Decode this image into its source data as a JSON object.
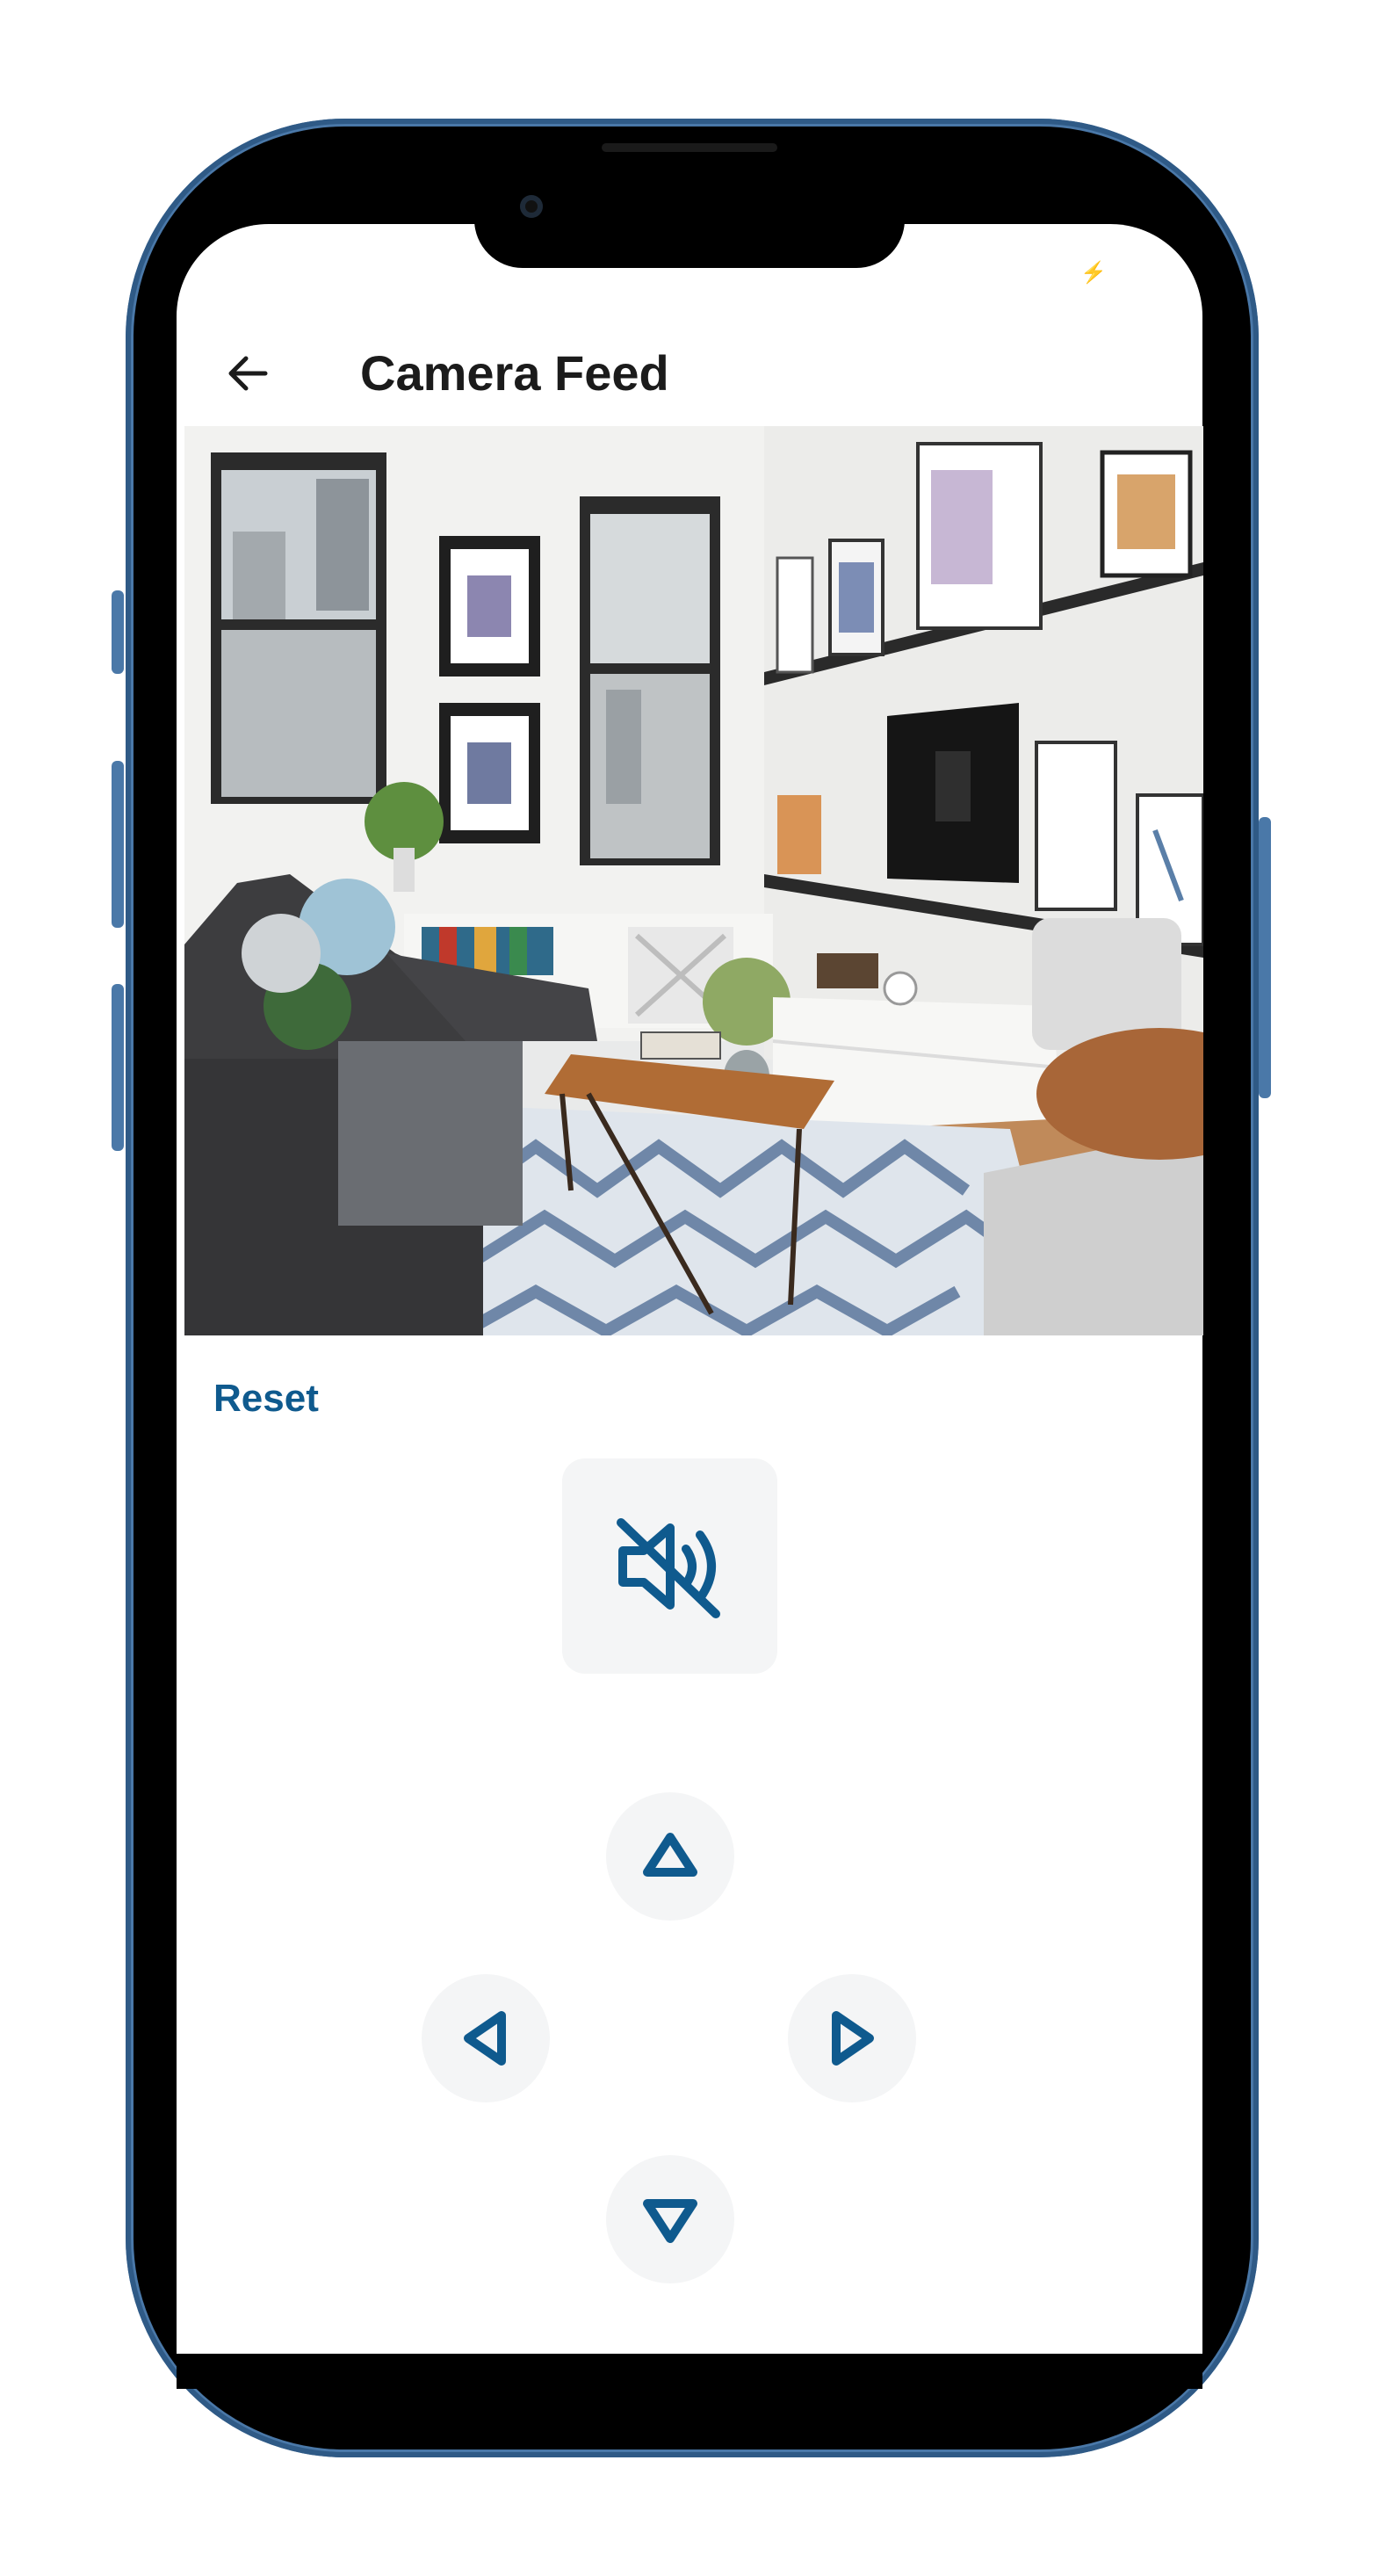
{
  "header": {
    "title": "Camera Feed",
    "back_icon": "arrow-left-icon"
  },
  "status_bar": {
    "indicator_icon": "charging-bolt-icon",
    "indicator_glyph": "⚡"
  },
  "feed": {
    "description_icon": "camera-feed-image"
  },
  "controls": {
    "reset_label": "Reset",
    "mute_icon": "speaker-muted-icon",
    "up_icon": "triangle-up-icon",
    "down_icon": "triangle-down-icon",
    "left_icon": "triangle-left-icon",
    "right_icon": "triangle-right-icon"
  },
  "colors": {
    "accent": "#0f5a8e",
    "frame": "#4a78a8",
    "button_bg": "#f4f5f6"
  }
}
